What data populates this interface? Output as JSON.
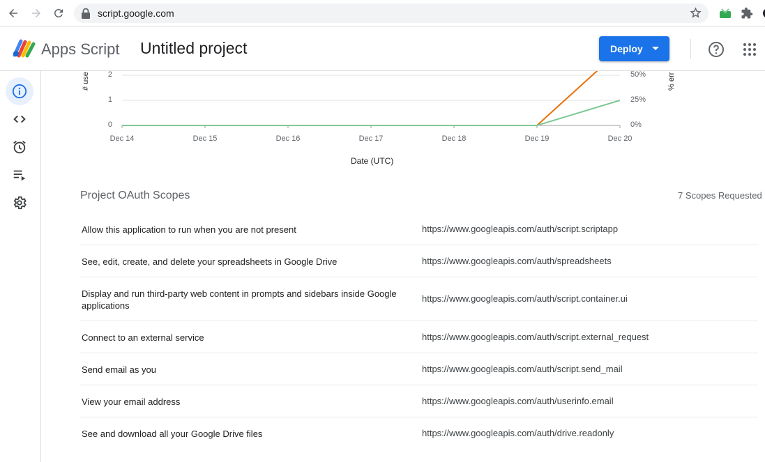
{
  "browser": {
    "url": "script.google.com"
  },
  "header": {
    "app_name": "Apps Script",
    "project_name": "Untitled project",
    "deploy_label": "Deploy"
  },
  "sidebar": {
    "items": [
      {
        "name": "overview",
        "icon": "info-icon",
        "active": true
      },
      {
        "name": "editor",
        "icon": "code-icon"
      },
      {
        "name": "triggers",
        "icon": "alarm-clock-icon"
      },
      {
        "name": "executions",
        "icon": "playlist-play-icon"
      },
      {
        "name": "settings",
        "icon": "gear-icon"
      }
    ]
  },
  "chart_data": {
    "type": "line",
    "x": [
      "Dec 14",
      "Dec 15",
      "Dec 16",
      "Dec 17",
      "Dec 18",
      "Dec 19",
      "Dec 20"
    ],
    "xlabel": "Date (UTC)",
    "ylabel_left": "# use",
    "ylabel_right": "% err",
    "left_ticks": [
      "0",
      "1",
      "2"
    ],
    "right_ticks": [
      "0%",
      "25%",
      "50%"
    ],
    "series": [
      {
        "color": "#e8710a",
        "values": [
          0,
          0,
          0,
          0,
          0,
          0,
          3
        ]
      },
      {
        "color": "#81c995",
        "values": [
          0,
          0,
          0,
          0,
          0,
          0,
          1
        ]
      }
    ]
  },
  "scopes": {
    "title": "Project OAuth Scopes",
    "count_label": "7 Scopes Requested",
    "rows": [
      {
        "description": "Allow this application to run when you are not present",
        "url": "https://www.googleapis.com/auth/script.scriptapp"
      },
      {
        "description": "See, edit, create, and delete your spreadsheets in Google Drive",
        "url": "https://www.googleapis.com/auth/spreadsheets"
      },
      {
        "description": "Display and run third-party web content in prompts and sidebars inside Google applications",
        "url": "https://www.googleapis.com/auth/script.container.ui"
      },
      {
        "description": "Connect to an external service",
        "url": "https://www.googleapis.com/auth/script.external_request"
      },
      {
        "description": "Send email as you",
        "url": "https://www.googleapis.com/auth/script.send_mail"
      },
      {
        "description": "View your email address",
        "url": "https://www.googleapis.com/auth/userinfo.email"
      },
      {
        "description": "See and download all your Google Drive files",
        "url": "https://www.googleapis.com/auth/drive.readonly"
      }
    ]
  }
}
